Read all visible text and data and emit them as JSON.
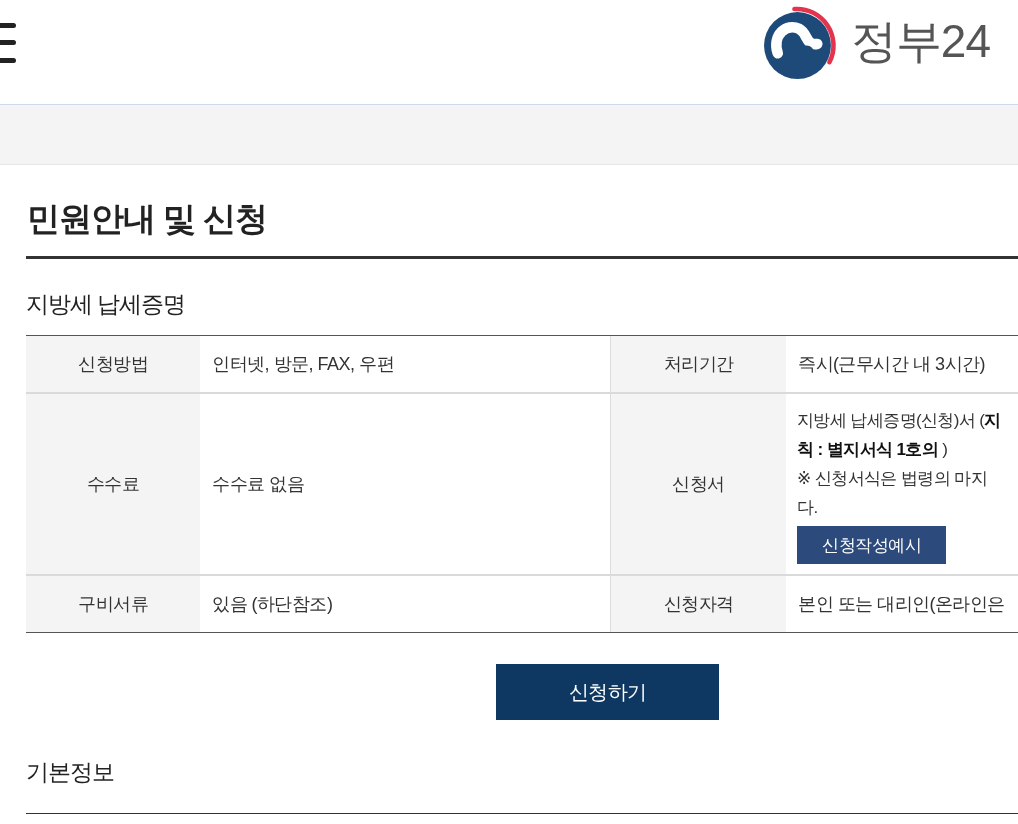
{
  "header": {
    "logo_text": "정부24"
  },
  "page_title": "민원안내 및 신청",
  "service_name": "지방세 납세증명",
  "info_table": {
    "rows": [
      {
        "cells": [
          {
            "label": "신청방법",
            "value": "인터넷, 방문, FAX, 우편"
          },
          {
            "label": "처리기간",
            "value": "즉시(근무시간 내 3시간)"
          }
        ]
      },
      {
        "cells": [
          {
            "label": "수수료",
            "value": "수수료 없음"
          },
          {
            "label": "신청서",
            "lines": [
              "지방세 납세증명(신청)서 (**지**",
              "**칙 : 별지서식 1호의** )",
              "※ 신청서식은 법령의 마지",
              "다."
            ],
            "button": "신청작성예시"
          }
        ]
      },
      {
        "cells": [
          {
            "label": "구비서류",
            "value": "있음 (하단참조)"
          },
          {
            "label": "신청자격",
            "value": "본인 또는 대리인(온라인은"
          }
        ]
      }
    ]
  },
  "apply_button": "신청하기",
  "section_title": "기본정보"
}
